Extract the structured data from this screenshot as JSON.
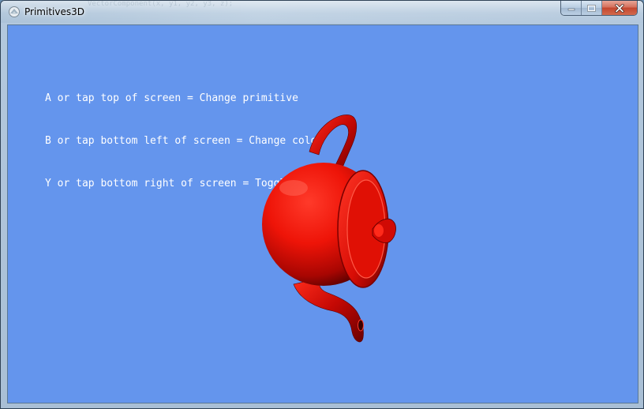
{
  "window": {
    "title": "Primitives3D",
    "background_code_ghost": "VectorComponent(x,  y1, y2, y3, z);",
    "accent_color": "#6495ed"
  },
  "caption_buttons": {
    "minimize_icon": "minimize-icon",
    "maximize_icon": "maximize-icon",
    "close_icon": "close-icon"
  },
  "viewport": {
    "background_color": "#6495ed",
    "instructions": [
      "A or tap top of screen = Change primitive",
      "B or tap bottom left of screen = Change color",
      "Y or tap bottom right of screen = Toggle wireframe"
    ],
    "primitive": "teapot",
    "primitive_color": "#ff0000",
    "wireframe": false
  }
}
